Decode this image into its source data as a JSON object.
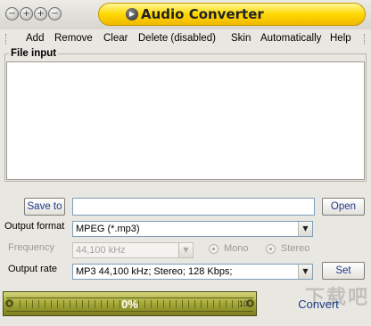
{
  "window": {
    "title": "Audio Converter",
    "buttons": [
      "−",
      "+",
      "+",
      "−"
    ]
  },
  "menu": {
    "items": [
      "Add",
      "Remove",
      "Clear",
      "Delete (disabled)",
      "Skin",
      "Automatically",
      "Help"
    ]
  },
  "file_input": {
    "label": "File input",
    "files": []
  },
  "save": {
    "button": "Save to",
    "path": "",
    "open_button": "Open"
  },
  "output_format": {
    "label": "Output format",
    "value": "MPEG (*.mp3)"
  },
  "frequency": {
    "label": "Frequency",
    "value": "44,100 kHz",
    "mono": "Mono",
    "stereo": "Stereo"
  },
  "output_rate": {
    "label": "Output rate",
    "value": "MP3 44,100 kHz; Stereo;  128 Kbps;",
    "set_button": "Set"
  },
  "progress": {
    "text": "0%",
    "value": 0,
    "min_label": "0",
    "max_label": "100"
  },
  "convert_button": "Convert",
  "watermark": "下载吧"
}
